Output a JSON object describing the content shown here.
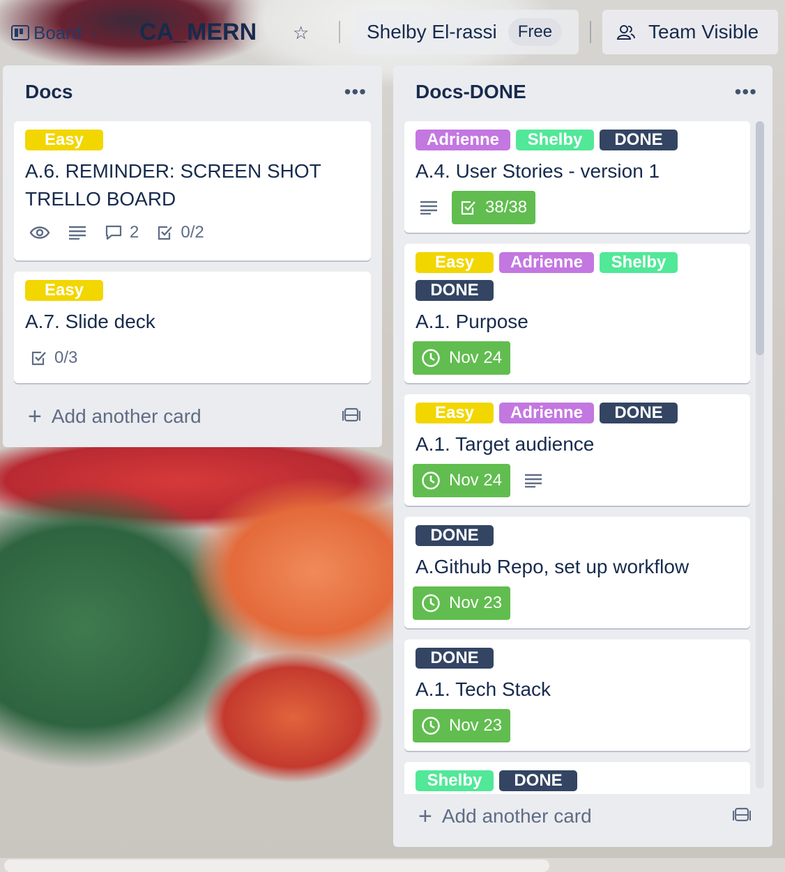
{
  "header": {
    "view_switcher": "Board",
    "board_name": "CA_MERN",
    "member_name": "Shelby El-rassi",
    "plan_badge": "Free",
    "visibility": "Team Visible"
  },
  "colors": {
    "label_yellow": "#f2d600",
    "label_purple": "#c377e0",
    "label_teal": "#51e898",
    "label_dark": "#344563",
    "badge_green": "#61bd4f"
  },
  "lists": [
    {
      "title": "Docs",
      "add_card": "Add another card",
      "cards": [
        {
          "labels": [
            "Easy"
          ],
          "title": "A.6. REMINDER: SCREEN SHOT TRELLO BOARD",
          "comments": "2",
          "checklist": "0/2"
        },
        {
          "labels": [
            "Easy"
          ],
          "title": "A.7. Slide deck",
          "checklist": "0/3"
        }
      ]
    },
    {
      "title": "Docs-DONE",
      "add_card": "Add another card",
      "cards": [
        {
          "labels": [
            "Adrienne",
            "Shelby",
            "DONE"
          ],
          "title": "A.4. User Stories - version 1",
          "checklist": "38/38"
        },
        {
          "labels": [
            "Easy",
            "Adrienne",
            "Shelby",
            "DONE"
          ],
          "title": "A.1. Purpose",
          "due": "Nov 24"
        },
        {
          "labels": [
            "Easy",
            "Adrienne",
            "DONE"
          ],
          "title": "A.1. Target audience",
          "due": "Nov 24"
        },
        {
          "labels": [
            "DONE"
          ],
          "title": "A.Github Repo, set up workflow",
          "due": "Nov 23"
        },
        {
          "labels": [
            "DONE"
          ],
          "title": "A.1. Tech Stack",
          "due": "Nov 23"
        },
        {
          "labels": [
            "Shelby",
            "DONE"
          ]
        }
      ]
    }
  ]
}
